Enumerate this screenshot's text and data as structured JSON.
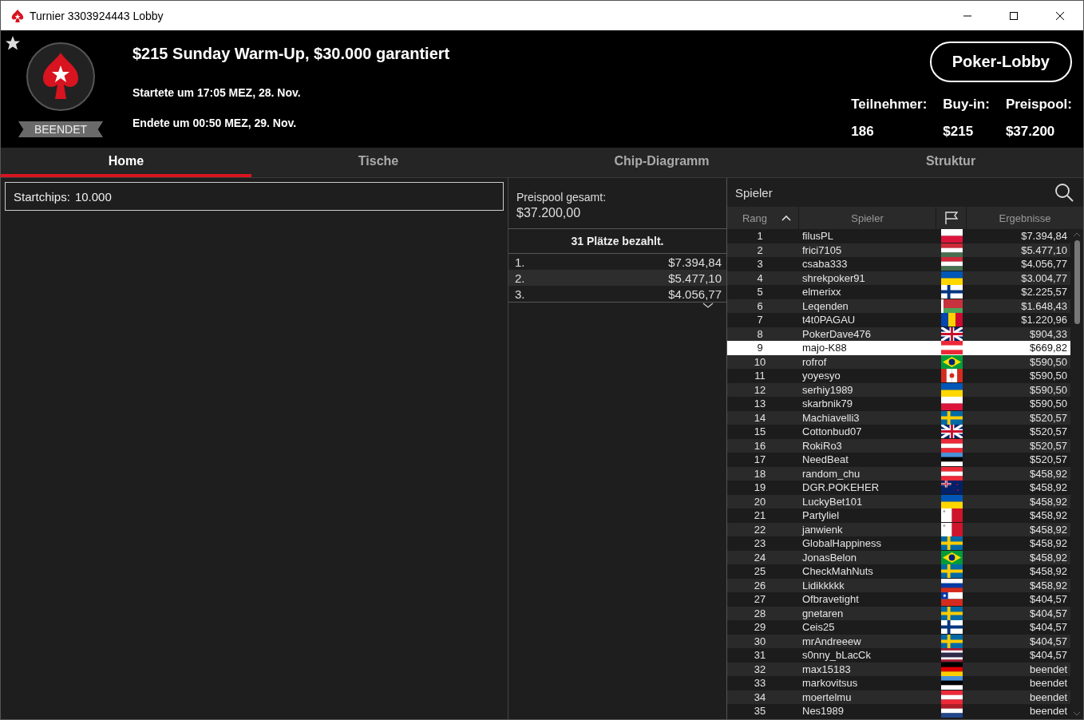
{
  "window": {
    "title": "Turnier 3303924443 Lobby"
  },
  "header": {
    "title": "$215 Sunday Warm-Up, $30.000 garantiert",
    "started": "Startete um 17:05 MEZ, 28. Nov.",
    "ended": "Endete um 00:50 MEZ, 29. Nov.",
    "status": "BEENDET",
    "lobby_button": "Poker-Lobby",
    "stats": [
      {
        "label": "Teilnehmer:",
        "value": "186"
      },
      {
        "label": "Buy-in:",
        "value": "$215"
      },
      {
        "label": "Preispool:",
        "value": "$37.200"
      }
    ]
  },
  "tabs": [
    {
      "label": "Home",
      "selected": true
    },
    {
      "label": "Tische",
      "selected": false
    },
    {
      "label": "Chip-Diagramm",
      "selected": false
    },
    {
      "label": "Struktur",
      "selected": false
    }
  ],
  "home": {
    "label": "Startchips:",
    "value": "10.000"
  },
  "prizes": {
    "label": "Preispool gesamt:",
    "total": "$37.200,00",
    "paid": "31 Plätze bezahlt.",
    "rows": [
      {
        "place": "1.",
        "amount": "$7.394,84"
      },
      {
        "place": "2.",
        "amount": "$5.477,10"
      },
      {
        "place": "3.",
        "amount": "$4.056,77"
      }
    ]
  },
  "players": {
    "title": "Spieler",
    "columns": [
      "Rang",
      "Spieler",
      "Ergebnisse"
    ],
    "rows": [
      {
        "rank": "1",
        "name": "filusPL",
        "kind": "pl",
        "result": "$7.394,84",
        "selected": false
      },
      {
        "rank": "2",
        "name": "frici7105",
        "kind": "hu",
        "result": "$5.477,10",
        "selected": false
      },
      {
        "rank": "3",
        "name": "csaba333",
        "kind": "hu",
        "result": "$4.056,77",
        "selected": false
      },
      {
        "rank": "4",
        "name": "shrekpoker91",
        "kind": "ua",
        "result": "$3.004,77",
        "selected": false
      },
      {
        "rank": "5",
        "name": "elmerixx",
        "kind": "fi",
        "result": "$2.225,57",
        "selected": false
      },
      {
        "rank": "6",
        "name": "Leqenden",
        "kind": "by",
        "result": "$1.648,43",
        "selected": false
      },
      {
        "rank": "7",
        "name": "t4t0PAGAU",
        "kind": "md",
        "result": "$1.220,96",
        "selected": false
      },
      {
        "rank": "8",
        "name": "PokerDave476",
        "kind": "gb",
        "result": "$904,33",
        "selected": false
      },
      {
        "rank": "9",
        "name": "majo-K88",
        "kind": "at",
        "result": "$669,82",
        "selected": true
      },
      {
        "rank": "10",
        "name": "rofrof",
        "kind": "br",
        "result": "$590,50",
        "selected": false
      },
      {
        "rank": "11",
        "name": "yoyesyo",
        "kind": "ca",
        "result": "$590,50",
        "selected": false
      },
      {
        "rank": "12",
        "name": "serhiy1989",
        "kind": "ua",
        "result": "$590,50",
        "selected": false
      },
      {
        "rank": "13",
        "name": "skarbnik79",
        "kind": "pl",
        "result": "$590,50",
        "selected": false
      },
      {
        "rank": "14",
        "name": "Machiavelli3",
        "kind": "se",
        "result": "$520,57",
        "selected": false
      },
      {
        "rank": "15",
        "name": "Cottonbud07",
        "kind": "gb",
        "result": "$520,57",
        "selected": false
      },
      {
        "rank": "16",
        "name": "RokiRo3",
        "kind": "at",
        "result": "$520,57",
        "selected": false
      },
      {
        "rank": "17",
        "name": "NeedBeat",
        "kind": "ee",
        "result": "$520,57",
        "selected": false
      },
      {
        "rank": "18",
        "name": "random_chu",
        "kind": "at",
        "result": "$458,92",
        "selected": false
      },
      {
        "rank": "19",
        "name": "DGR.POKEHER",
        "kind": "nz",
        "result": "$458,92",
        "selected": false
      },
      {
        "rank": "20",
        "name": "LuckyBet101",
        "kind": "ua",
        "result": "$458,92",
        "selected": false
      },
      {
        "rank": "21",
        "name": "Partyliel",
        "kind": "mt",
        "result": "$458,92",
        "selected": false
      },
      {
        "rank": "22",
        "name": "janwienk",
        "kind": "mt",
        "result": "$458,92",
        "selected": false
      },
      {
        "rank": "23",
        "name": "GlobalHappiness",
        "kind": "se",
        "result": "$458,92",
        "selected": false
      },
      {
        "rank": "24",
        "name": "JonasBelon",
        "kind": "br",
        "result": "$458,92",
        "selected": false
      },
      {
        "rank": "25",
        "name": "CheckMahNuts",
        "kind": "se",
        "result": "$458,92",
        "selected": false
      },
      {
        "rank": "26",
        "name": "Lidikkkkk",
        "kind": "ru",
        "result": "$458,92",
        "selected": false
      },
      {
        "rank": "27",
        "name": "Ofbravetight",
        "kind": "cl",
        "result": "$404,57",
        "selected": false
      },
      {
        "rank": "28",
        "name": "gnetaren",
        "kind": "se",
        "result": "$404,57",
        "selected": false
      },
      {
        "rank": "29",
        "name": "Ceis25",
        "kind": "fi",
        "result": "$404,57",
        "selected": false
      },
      {
        "rank": "30",
        "name": "mrAndreeew",
        "kind": "se",
        "result": "$404,57",
        "selected": false
      },
      {
        "rank": "31",
        "name": "s0nny_bLacCk",
        "kind": "th",
        "result": "$404,57",
        "selected": false
      },
      {
        "rank": "32",
        "name": "max15183",
        "kind": "de",
        "result": "beendet",
        "selected": false
      },
      {
        "rank": "33",
        "name": "markovitsus",
        "kind": "ee",
        "result": "beendet",
        "selected": false
      },
      {
        "rank": "34",
        "name": "moertelmu",
        "kind": "at",
        "result": "beendet",
        "selected": false
      },
      {
        "rank": "35",
        "name": "Nes1989",
        "kind": "nl",
        "result": "beendet",
        "selected": false
      }
    ]
  }
}
